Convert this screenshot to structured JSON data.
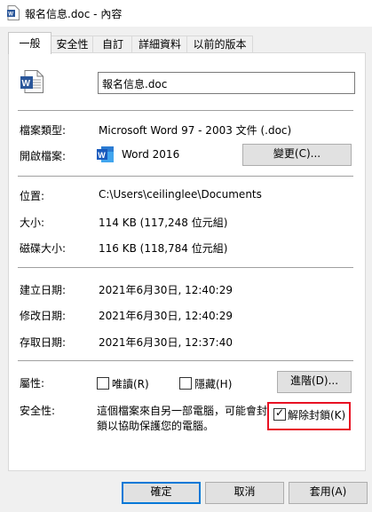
{
  "window": {
    "title": "報名信息.doc - 內容"
  },
  "tabs": [
    "一般",
    "安全性",
    "自訂",
    "詳細資料",
    "以前的版本"
  ],
  "general": {
    "filename": "報名信息.doc",
    "file_type_label": "檔案類型:",
    "file_type_value": "Microsoft Word 97 - 2003 文件 (.doc)",
    "opens_with_label": "開啟檔案:",
    "opens_with_value": "Word 2016",
    "change_button": "變更(C)...",
    "location_label": "位置:",
    "location_value": "C:\\Users\\ceilinglee\\Documents",
    "size_label": "大小:",
    "size_value": "114 KB (117,248 位元組)",
    "size_on_disk_label": "磁碟大小:",
    "size_on_disk_value": "116 KB (118,784 位元組)",
    "created_label": "建立日期:",
    "created_value": "2021年6月30日, 12:40:29",
    "modified_label": "修改日期:",
    "modified_value": "2021年6月30日, 12:40:29",
    "accessed_label": "存取日期:",
    "accessed_value": "2021年6月30日, 12:37:40",
    "attributes_label": "屬性:",
    "readonly_label": "唯讀(R)",
    "readonly_checked": false,
    "hidden_label": "隱藏(H)",
    "hidden_checked": false,
    "advanced_button": "進階(D)...",
    "security_label": "安全性:",
    "security_text_line1": "這個檔案來自另一部電腦，可能會封",
    "security_text_line2": "鎖以協助保護您的電腦。",
    "unblock_label": "解除封鎖(K)",
    "unblock_checked": true
  },
  "footer": {
    "ok": "確定",
    "cancel": "取消",
    "apply": "套用(A)"
  },
  "colors": {
    "word_blue": "#2b579a",
    "highlight_red": "#e81123",
    "accent": "#0078d7"
  },
  "icons": [
    "word-document-icon",
    "word-app-icon",
    "checkbox-checked-icon"
  ]
}
